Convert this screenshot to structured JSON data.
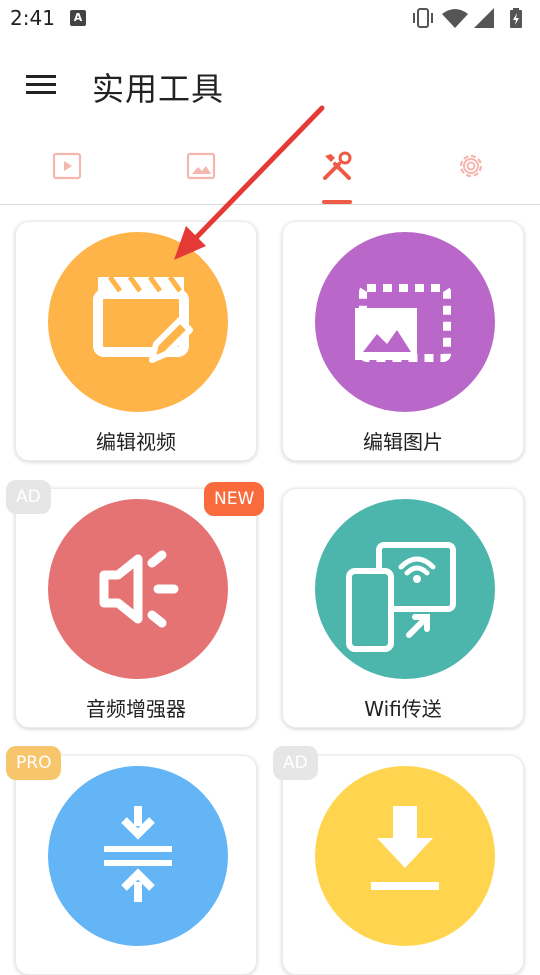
{
  "status": {
    "time": "2:41",
    "notif_letter": "A"
  },
  "header": {
    "title": "实用工具"
  },
  "tabs": [
    {
      "id": "video",
      "icon": "video-play-icon"
    },
    {
      "id": "image",
      "icon": "image-icon"
    },
    {
      "id": "tools",
      "icon": "tools-icon",
      "active": true
    },
    {
      "id": "settings",
      "icon": "gear-icon"
    }
  ],
  "cards": [
    {
      "label": "编辑视频",
      "color": "#ffb44a",
      "icon": "clapperboard-edit-icon"
    },
    {
      "label": "编辑图片",
      "color": "#b967c9",
      "icon": "image-crop-icon"
    },
    {
      "label": "音频增强器",
      "color": "#e57373",
      "icon": "speaker-boost-icon",
      "badges": [
        "AD",
        "NEW"
      ]
    },
    {
      "label": "Wifi传送",
      "color": "#4db6ac",
      "icon": "phone-to-screen-icon"
    },
    {
      "label": "",
      "color": "#64b5f6",
      "icon": "compress-icon",
      "badges": [
        "PRO"
      ]
    },
    {
      "label": "",
      "color": "#ffd54f",
      "icon": "download-icon",
      "badges": [
        "AD"
      ]
    }
  ],
  "colors": {
    "accent": "#ef5a46",
    "annotation_arrow": "#e53935"
  }
}
